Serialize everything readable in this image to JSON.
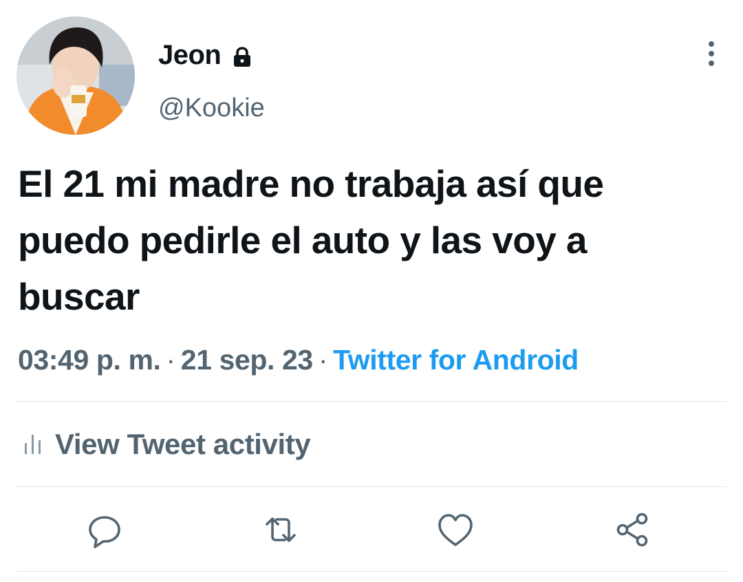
{
  "user": {
    "display_name": "Jeon",
    "handle": "@Kookie",
    "protected_icon": "lock-icon",
    "avatar_icon": "profile-photo"
  },
  "tweet": {
    "text": "El 21 mi madre no trabaja así que puedo pedirle el auto y las voy a buscar",
    "time": "03:49 p. m.",
    "separator": "·",
    "date": "21 sep. 23",
    "source": "Twitter for Android"
  },
  "activity": {
    "label": "View Tweet activity",
    "icon": "bar-chart-icon"
  },
  "actions": {
    "reply_icon": "reply-icon",
    "retweet_icon": "retweet-icon",
    "like_icon": "heart-icon",
    "share_icon": "share-icon"
  },
  "menu": {
    "icon": "more-vertical-icon"
  },
  "colors": {
    "text": "#0f1419",
    "secondary": "#536471",
    "link": "#1d9bf0",
    "divider": "#e1e5e8",
    "avatar_jacket": "#f28b2c"
  }
}
